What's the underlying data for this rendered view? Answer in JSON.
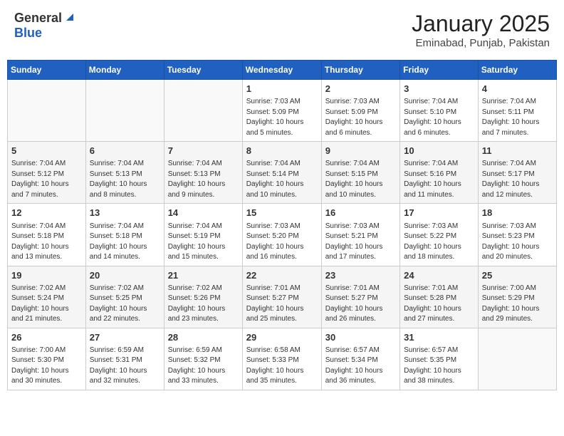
{
  "logo": {
    "general": "General",
    "blue": "Blue"
  },
  "title": "January 2025",
  "subtitle": "Eminabad, Punjab, Pakistan",
  "days_of_week": [
    "Sunday",
    "Monday",
    "Tuesday",
    "Wednesday",
    "Thursday",
    "Friday",
    "Saturday"
  ],
  "weeks": [
    [
      {
        "day": "",
        "content": ""
      },
      {
        "day": "",
        "content": ""
      },
      {
        "day": "",
        "content": ""
      },
      {
        "day": "1",
        "content": "Sunrise: 7:03 AM\nSunset: 5:09 PM\nDaylight: 10 hours\nand 5 minutes."
      },
      {
        "day": "2",
        "content": "Sunrise: 7:03 AM\nSunset: 5:09 PM\nDaylight: 10 hours\nand 6 minutes."
      },
      {
        "day": "3",
        "content": "Sunrise: 7:04 AM\nSunset: 5:10 PM\nDaylight: 10 hours\nand 6 minutes."
      },
      {
        "day": "4",
        "content": "Sunrise: 7:04 AM\nSunset: 5:11 PM\nDaylight: 10 hours\nand 7 minutes."
      }
    ],
    [
      {
        "day": "5",
        "content": "Sunrise: 7:04 AM\nSunset: 5:12 PM\nDaylight: 10 hours\nand 7 minutes."
      },
      {
        "day": "6",
        "content": "Sunrise: 7:04 AM\nSunset: 5:13 PM\nDaylight: 10 hours\nand 8 minutes."
      },
      {
        "day": "7",
        "content": "Sunrise: 7:04 AM\nSunset: 5:13 PM\nDaylight: 10 hours\nand 9 minutes."
      },
      {
        "day": "8",
        "content": "Sunrise: 7:04 AM\nSunset: 5:14 PM\nDaylight: 10 hours\nand 10 minutes."
      },
      {
        "day": "9",
        "content": "Sunrise: 7:04 AM\nSunset: 5:15 PM\nDaylight: 10 hours\nand 10 minutes."
      },
      {
        "day": "10",
        "content": "Sunrise: 7:04 AM\nSunset: 5:16 PM\nDaylight: 10 hours\nand 11 minutes."
      },
      {
        "day": "11",
        "content": "Sunrise: 7:04 AM\nSunset: 5:17 PM\nDaylight: 10 hours\nand 12 minutes."
      }
    ],
    [
      {
        "day": "12",
        "content": "Sunrise: 7:04 AM\nSunset: 5:18 PM\nDaylight: 10 hours\nand 13 minutes."
      },
      {
        "day": "13",
        "content": "Sunrise: 7:04 AM\nSunset: 5:18 PM\nDaylight: 10 hours\nand 14 minutes."
      },
      {
        "day": "14",
        "content": "Sunrise: 7:04 AM\nSunset: 5:19 PM\nDaylight: 10 hours\nand 15 minutes."
      },
      {
        "day": "15",
        "content": "Sunrise: 7:03 AM\nSunset: 5:20 PM\nDaylight: 10 hours\nand 16 minutes."
      },
      {
        "day": "16",
        "content": "Sunrise: 7:03 AM\nSunset: 5:21 PM\nDaylight: 10 hours\nand 17 minutes."
      },
      {
        "day": "17",
        "content": "Sunrise: 7:03 AM\nSunset: 5:22 PM\nDaylight: 10 hours\nand 18 minutes."
      },
      {
        "day": "18",
        "content": "Sunrise: 7:03 AM\nSunset: 5:23 PM\nDaylight: 10 hours\nand 20 minutes."
      }
    ],
    [
      {
        "day": "19",
        "content": "Sunrise: 7:02 AM\nSunset: 5:24 PM\nDaylight: 10 hours\nand 21 minutes."
      },
      {
        "day": "20",
        "content": "Sunrise: 7:02 AM\nSunset: 5:25 PM\nDaylight: 10 hours\nand 22 minutes."
      },
      {
        "day": "21",
        "content": "Sunrise: 7:02 AM\nSunset: 5:26 PM\nDaylight: 10 hours\nand 23 minutes."
      },
      {
        "day": "22",
        "content": "Sunrise: 7:01 AM\nSunset: 5:27 PM\nDaylight: 10 hours\nand 25 minutes."
      },
      {
        "day": "23",
        "content": "Sunrise: 7:01 AM\nSunset: 5:27 PM\nDaylight: 10 hours\nand 26 minutes."
      },
      {
        "day": "24",
        "content": "Sunrise: 7:01 AM\nSunset: 5:28 PM\nDaylight: 10 hours\nand 27 minutes."
      },
      {
        "day": "25",
        "content": "Sunrise: 7:00 AM\nSunset: 5:29 PM\nDaylight: 10 hours\nand 29 minutes."
      }
    ],
    [
      {
        "day": "26",
        "content": "Sunrise: 7:00 AM\nSunset: 5:30 PM\nDaylight: 10 hours\nand 30 minutes."
      },
      {
        "day": "27",
        "content": "Sunrise: 6:59 AM\nSunset: 5:31 PM\nDaylight: 10 hours\nand 32 minutes."
      },
      {
        "day": "28",
        "content": "Sunrise: 6:59 AM\nSunset: 5:32 PM\nDaylight: 10 hours\nand 33 minutes."
      },
      {
        "day": "29",
        "content": "Sunrise: 6:58 AM\nSunset: 5:33 PM\nDaylight: 10 hours\nand 35 minutes."
      },
      {
        "day": "30",
        "content": "Sunrise: 6:57 AM\nSunset: 5:34 PM\nDaylight: 10 hours\nand 36 minutes."
      },
      {
        "day": "31",
        "content": "Sunrise: 6:57 AM\nSunset: 5:35 PM\nDaylight: 10 hours\nand 38 minutes."
      },
      {
        "day": "",
        "content": ""
      }
    ]
  ]
}
